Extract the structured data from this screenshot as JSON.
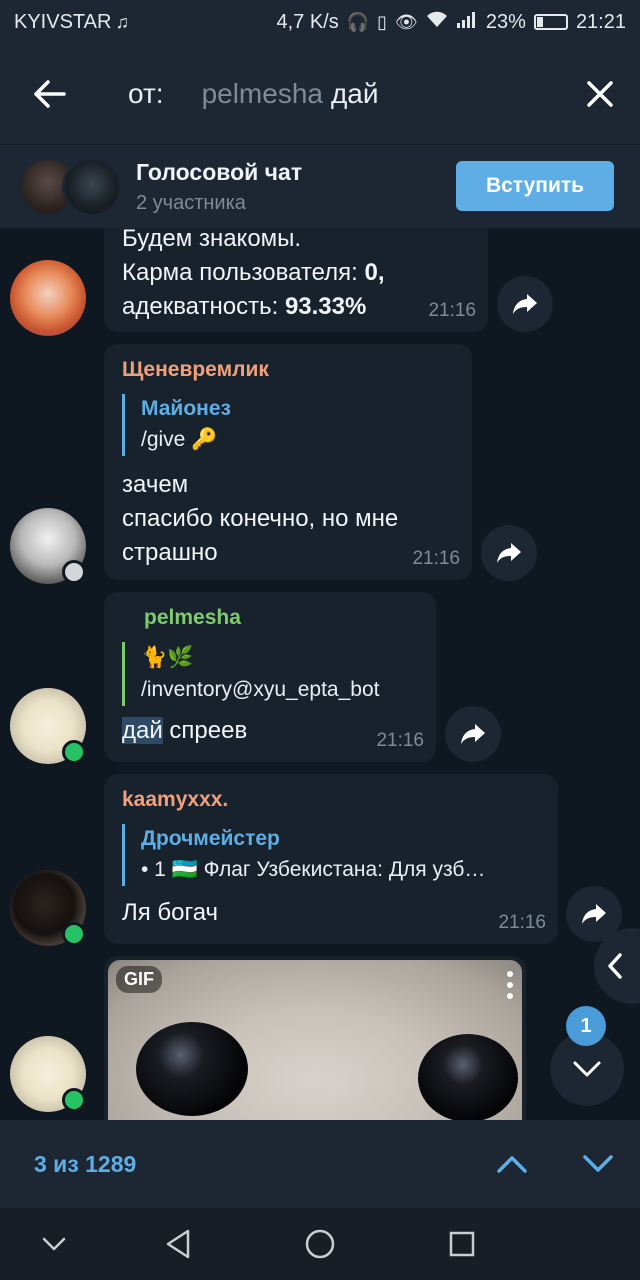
{
  "status_bar": {
    "carrier": "KYIVSTAR",
    "speed": "4,7 K/s",
    "battery": "23%",
    "battery_level": 0.23,
    "time": "21:21"
  },
  "search": {
    "prefix": "от:",
    "user": "pelmesha",
    "query": "дай"
  },
  "voice_chat": {
    "title": "Голосовой чат",
    "participants": "2 участника",
    "join_label": "Вступить"
  },
  "messages": [
    {
      "lines": [
        "Будем знакомы.",
        "Карма пользователя: ",
        "адекватность: "
      ],
      "karma": "0,",
      "adequacy": "93.33%",
      "time": "21:16"
    },
    {
      "sender": "Щеневремлик",
      "sender_color": "#f0a07a",
      "reply_name": "Майонез",
      "reply_text": "/give 🔑",
      "lines": [
        "зачем",
        "спасибо конечно, но мне",
        "страшно"
      ],
      "time": "21:16"
    },
    {
      "sender": "pelmesha",
      "sender_color": "#7ecb6c",
      "reply_emoji": "🐈🌿",
      "reply_text": "/inventory@xyu_epta_bot",
      "highlight": "дай",
      "rest": " спреев",
      "time": "21:16"
    },
    {
      "sender": "kaamyxxx.",
      "sender_color": "#f0a07a",
      "reply_name": "Дрочмейстер",
      "reply_text": "• 1 🇺🇿 Флаг Узбекистана: Для узб…",
      "lines": [
        "Ля богач"
      ],
      "time": "21:16"
    },
    {
      "gif_label": "GIF"
    }
  ],
  "unread_count": "1",
  "search_nav": {
    "count_text": "3 из 1289"
  },
  "icons": {
    "back": "arrow-left-icon",
    "close": "close-icon",
    "forward": "share-arrow-icon",
    "up": "chevron-up-icon",
    "down": "chevron-down-icon"
  },
  "colors": {
    "accent": "#5eaee5",
    "header_bg": "#1d2733",
    "chat_bg": "#0f1820",
    "bubble_bg": "#18222d",
    "online": "#27c264"
  }
}
